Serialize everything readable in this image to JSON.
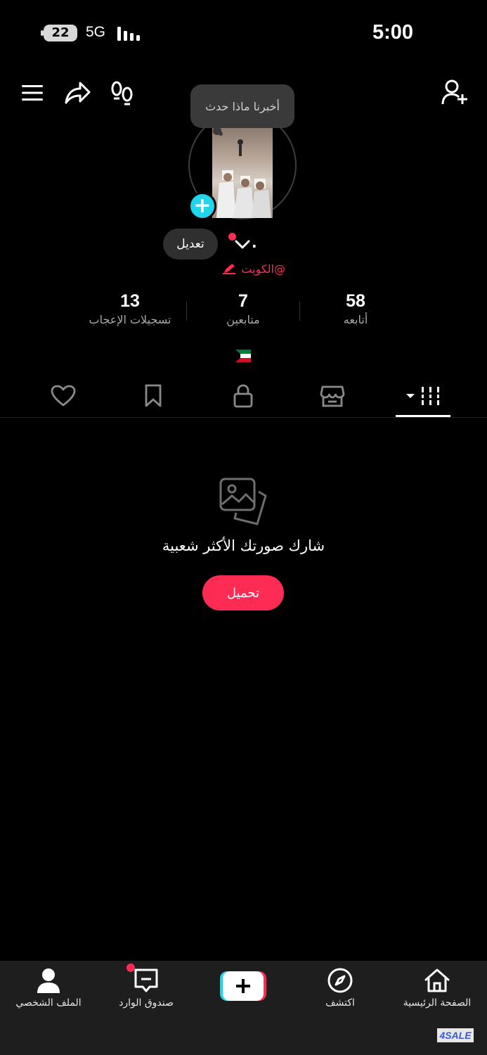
{
  "status_bar": {
    "battery": "22",
    "network": "5G",
    "time": "5:00"
  },
  "header": {
    "menu_icon": "menu-icon",
    "share_icon": "share-icon",
    "footprints_icon": "footprints-icon",
    "add_friend_icon": "add-friend-icon"
  },
  "tooltip": {
    "text": "أخبرنا ماذا حدث"
  },
  "profile": {
    "edit_label": "تعديل",
    "name": ".",
    "handle": "@الكويت",
    "flag": "kuwait-flag"
  },
  "stats": [
    {
      "value": "58",
      "label": "أتابعه"
    },
    {
      "value": "7",
      "label": "متابعين"
    },
    {
      "value": "13",
      "label": "تسجيلات الإعجاب"
    }
  ],
  "tabs": [
    "grid-icon",
    "shop-icon",
    "lock-icon",
    "bookmark-icon",
    "heart-icon"
  ],
  "empty_state": {
    "text": "شارك صورتك الأكثر شعبية",
    "button": "تحميل"
  },
  "bottom_nav": {
    "home": "الصفحة الرئيسية",
    "discover": "اكتشف",
    "inbox": "صندوق الوارد",
    "profile": "الملف الشخصي"
  },
  "watermark": "4SALE",
  "colors": {
    "accent": "#fe2c55",
    "cyan": "#20d5ec",
    "background": "#000000",
    "nav_bg": "#1e1e1e"
  }
}
